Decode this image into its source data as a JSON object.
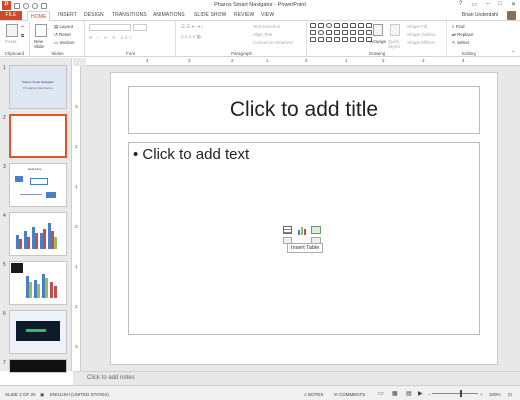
{
  "window": {
    "title": "Pharos Smart Navigator - PowerPoint",
    "user": "Brian Underdahl"
  },
  "tabs": [
    "FILE",
    "HOME",
    "INSERT",
    "DESIGN",
    "TRANSITIONS",
    "ANIMATIONS",
    "SLIDE SHOW",
    "REVIEW",
    "VIEW"
  ],
  "ribbon": {
    "clipboard": {
      "label": "Clipboard",
      "paste": "Paste"
    },
    "slides": {
      "label": "Slides",
      "new_slide": "New Slide",
      "layout": "Layout",
      "reset": "Reset",
      "section": "Section"
    },
    "font": {
      "label": "Font"
    },
    "paragraph": {
      "label": "Paragraph",
      "text_direction": "Text Direction",
      "align_text": "Align Text",
      "convert_smartart": "Convert to SmartArt"
    },
    "drawing": {
      "label": "Drawing",
      "arrange": "Arrange",
      "quick_styles": "Quick Styles",
      "shape_fill": "Shape Fill",
      "shape_outline": "Shape Outline",
      "shape_effects": "Shape Effects"
    },
    "editing": {
      "label": "Editing",
      "find": "Find",
      "replace": "Replace",
      "select": "Select"
    }
  },
  "thumbnails": [
    {
      "num": "1",
      "title": "Pharos Smart Navigator",
      "subtitle": "PF Graphics Data Sources"
    },
    {
      "num": "2"
    },
    {
      "num": "3",
      "title": "Data Flow"
    },
    {
      "num": "4"
    },
    {
      "num": "5"
    },
    {
      "num": "6"
    },
    {
      "num": "7"
    }
  ],
  "slide": {
    "title_placeholder": "Click to add title",
    "body_placeholder": "Click to add text",
    "tooltip": "Insert Table"
  },
  "notes": {
    "placeholder": "Click to add notes"
  },
  "status": {
    "slide": "SLIDE 2 OF 20",
    "language": "ENGLISH (UNITED STATES)",
    "notes": "NOTES",
    "comments": "COMMENTS",
    "zoom": "100%"
  },
  "ruler": {
    "h": [
      "4",
      "3",
      "2",
      "1",
      "0",
      "1",
      "2",
      "3",
      "4"
    ],
    "v": [
      "3",
      "2",
      "1",
      "0",
      "1",
      "2",
      "3"
    ]
  },
  "colors": {
    "accent": "#d24726",
    "selection": "#e0542c"
  }
}
